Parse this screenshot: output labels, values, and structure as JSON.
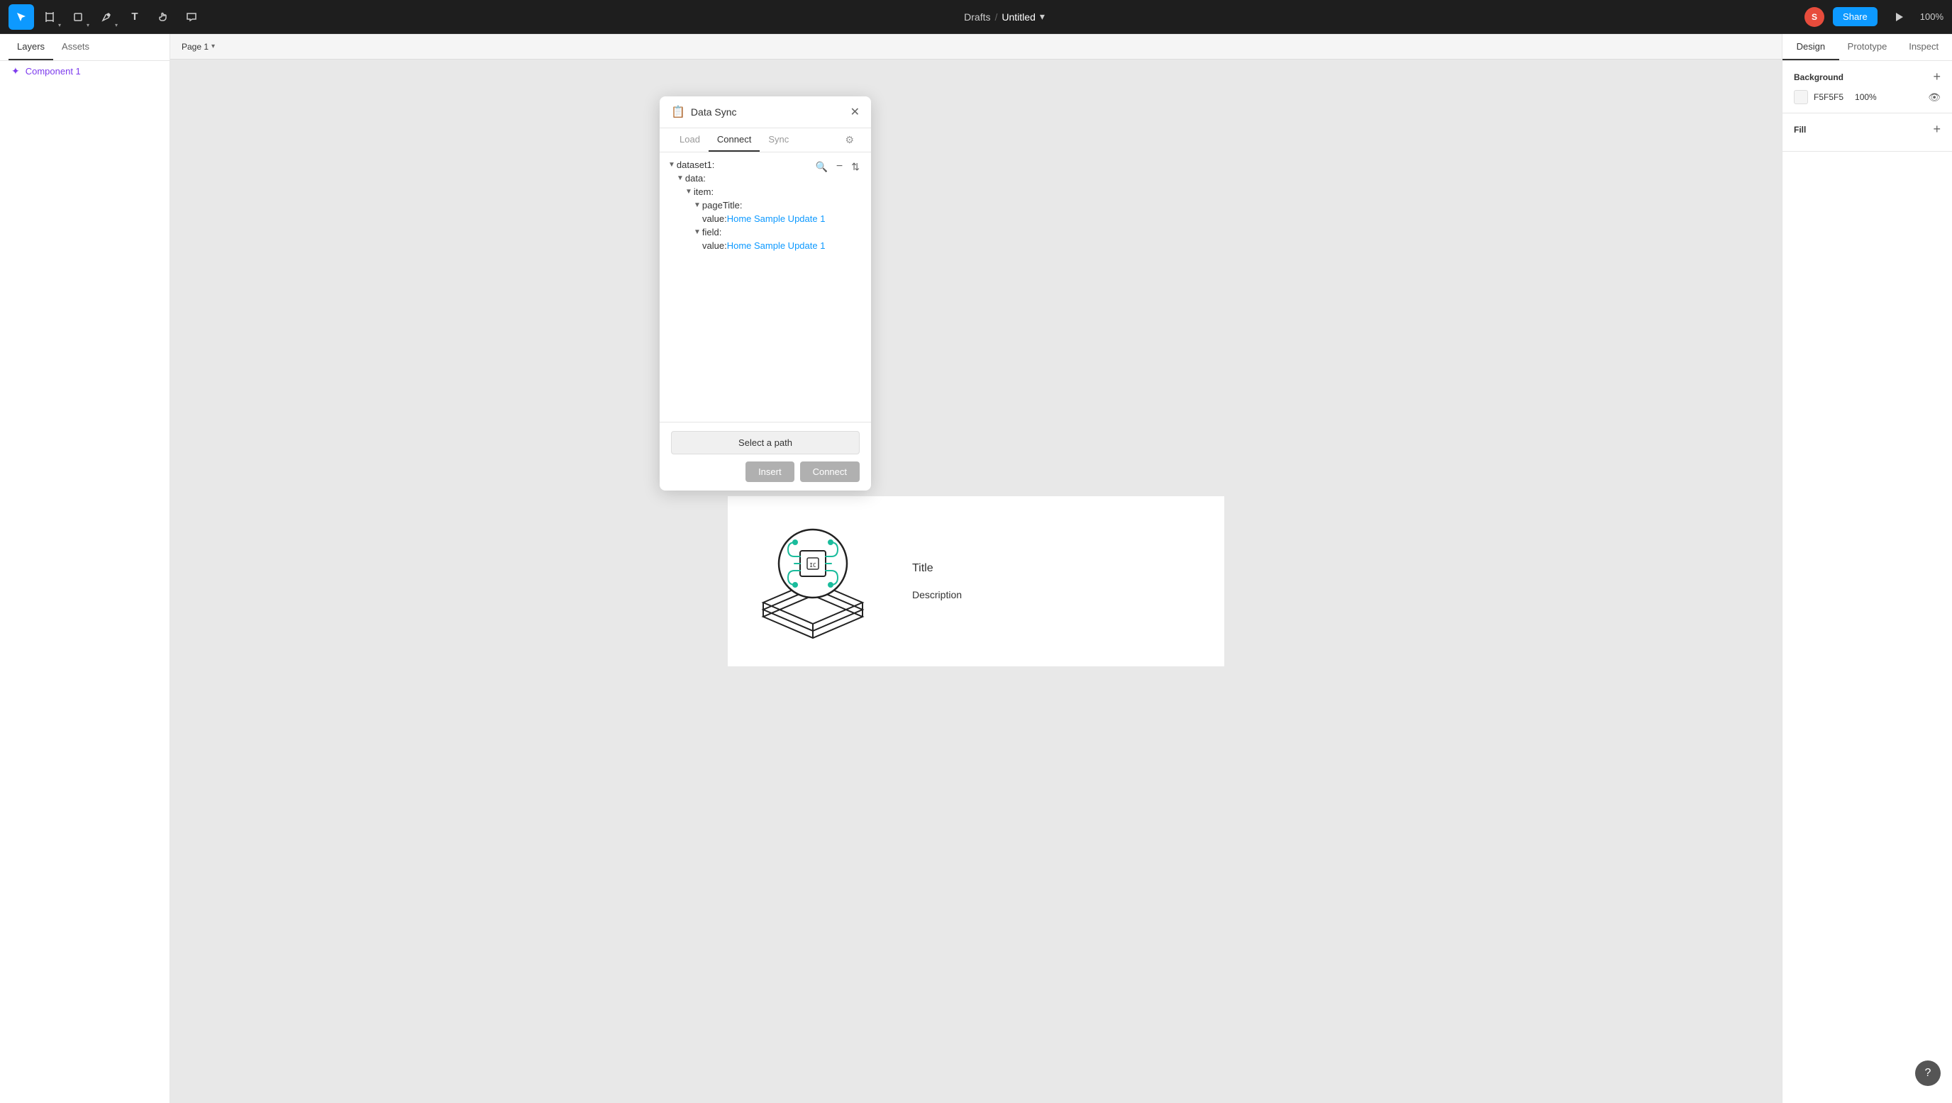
{
  "toolbar": {
    "drafts_label": "Drafts",
    "separator": "/",
    "title": "Untitled",
    "share_label": "Share",
    "zoom_level": "100%",
    "avatar_initials": "S",
    "tools": [
      {
        "name": "move",
        "icon": "↖",
        "active": true
      },
      {
        "name": "frame",
        "icon": "⊡"
      },
      {
        "name": "shape",
        "icon": "□"
      },
      {
        "name": "pen",
        "icon": "✒"
      },
      {
        "name": "text",
        "icon": "T"
      },
      {
        "name": "hand",
        "icon": "✋"
      },
      {
        "name": "comment",
        "icon": "💬"
      }
    ]
  },
  "left_panel": {
    "tabs": [
      "Layers",
      "Assets"
    ],
    "active_tab": "Layers",
    "layers": [
      {
        "name": "Component 1",
        "type": "component"
      }
    ]
  },
  "page": {
    "tab_label": "Page 1"
  },
  "component": {
    "label": "Component 1",
    "title": "Title",
    "description": "Description"
  },
  "right_panel": {
    "tabs": [
      "Design",
      "Prototype",
      "Inspect"
    ],
    "active_tab": "Design",
    "background": {
      "label": "Background",
      "color_hex": "F5F5F5",
      "opacity": "100%"
    }
  },
  "data_sync": {
    "title": "Data Sync",
    "tabs": [
      "Load",
      "Connect",
      "Sync"
    ],
    "active_tab": "Connect",
    "tree": {
      "dataset": "dataset1:",
      "data": "data:",
      "item": "item:",
      "pageTitle": "pageTitle:",
      "pageTitle_value_key": "value: ",
      "pageTitle_value": "Home Sample Update 1",
      "field": "field:",
      "field_value_key": "value: ",
      "field_value": "Home Sample Update 1"
    },
    "select_path_label": "Select a path",
    "insert_label": "Insert",
    "connect_label": "Connect"
  },
  "help": {
    "icon": "?"
  }
}
